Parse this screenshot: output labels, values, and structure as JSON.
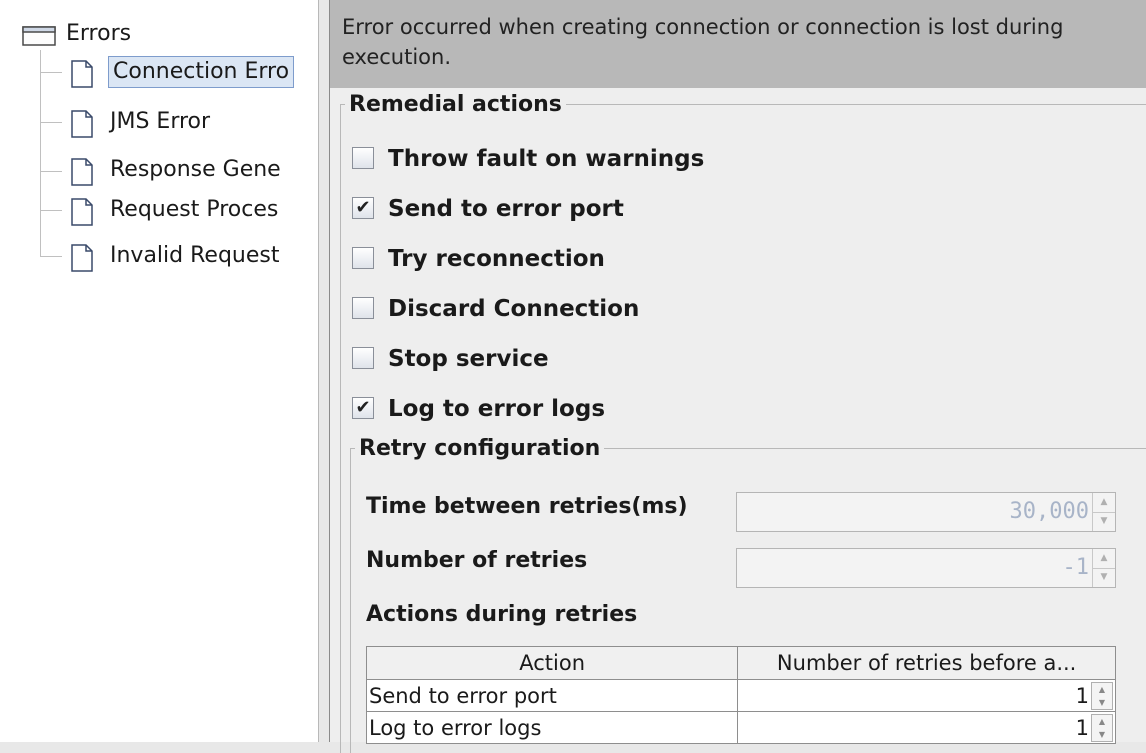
{
  "tree": {
    "root": "Errors",
    "items": [
      {
        "label": "Connection Erro",
        "selected": true
      },
      {
        "label": "JMS Error",
        "selected": false
      },
      {
        "label": "Response Gene",
        "selected": false
      },
      {
        "label": "Request Proces",
        "selected": false
      },
      {
        "label": "Invalid Request",
        "selected": false
      }
    ]
  },
  "description": "Error occurred when creating connection or connection is lost during execution.",
  "remedial": {
    "title": "Remedial actions",
    "options": [
      {
        "label": "Throw fault on warnings",
        "checked": false
      },
      {
        "label": "Send to error port",
        "checked": true
      },
      {
        "label": "Try reconnection",
        "checked": false
      },
      {
        "label": "Discard Connection",
        "checked": false
      },
      {
        "label": "Stop service",
        "checked": false
      },
      {
        "label": "Log to error logs",
        "checked": true
      }
    ],
    "check_mark": "✔"
  },
  "retry": {
    "title": "Retry configuration",
    "time_label": "Time between retries(ms)",
    "time_value": "30,000",
    "count_label": "Number of retries",
    "count_value": "-1",
    "actions_label": "Actions during retries",
    "table": {
      "headers": [
        "Action",
        "Number of retries before a..."
      ],
      "rows": [
        [
          "Send to error port",
          "1"
        ],
        [
          "Log to error logs",
          "1"
        ]
      ]
    }
  }
}
